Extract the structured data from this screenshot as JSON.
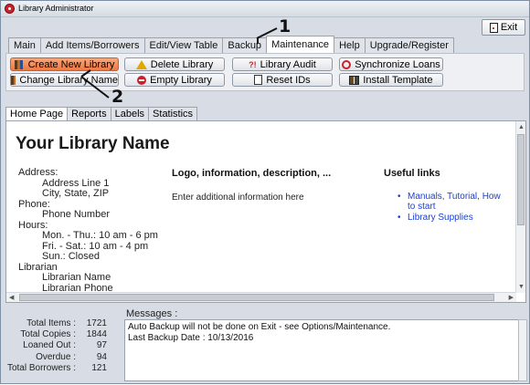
{
  "window": {
    "title": "Library Administrator"
  },
  "toolbar": {
    "exit_label": "Exit"
  },
  "main_tabs": [
    {
      "label": "Main"
    },
    {
      "label": "Add Items/Borrowers"
    },
    {
      "label": "Edit/View Table"
    },
    {
      "label": "Backup"
    },
    {
      "label": "Maintenance"
    },
    {
      "label": "Help"
    },
    {
      "label": "Upgrade/Register"
    }
  ],
  "ribbon": {
    "create_new_library": "Create New Library",
    "change_library_name": "Change Library Name",
    "delete_library": "Delete Library",
    "empty_library": "Empty Library",
    "library_audit": "Library Audit",
    "reset_ids": "Reset IDs",
    "synchronize_loans": "Synchronize Loans",
    "install_template": "Install Template",
    "audit_icon_text": "?!"
  },
  "sub_tabs": [
    {
      "label": "Home Page"
    },
    {
      "label": "Reports"
    },
    {
      "label": "Labels"
    },
    {
      "label": "Statistics"
    }
  ],
  "home": {
    "library_name": "Your Library Name",
    "address_lines": [
      {
        "text": "Address:",
        "indent": false
      },
      {
        "text": "Address Line 1",
        "indent": true
      },
      {
        "text": "City, State, ZIP",
        "indent": true
      },
      {
        "text": "Phone:",
        "indent": false
      },
      {
        "text": "Phone Number",
        "indent": true
      },
      {
        "text": "Hours:",
        "indent": false
      },
      {
        "text": "Mon. - Thu.: 10 am - 6 pm",
        "indent": true
      },
      {
        "text": "Fri. - Sat.: 10 am - 4 pm",
        "indent": true
      },
      {
        "text": "Sun.: Closed",
        "indent": true
      },
      {
        "text": "Librarian",
        "indent": false
      },
      {
        "text": "Librarian Name",
        "indent": true
      },
      {
        "text": "Librarian Phone",
        "indent": true
      }
    ],
    "middle_heading": "Logo, information, description, ...",
    "middle_text": "Enter additional information here",
    "links_heading": "Useful links",
    "links": [
      "Manuals, Tutorial, How to start",
      "Library Supplies"
    ]
  },
  "stats": [
    {
      "label": "Total Items :",
      "value": "1721"
    },
    {
      "label": "Total Copies :",
      "value": "1844"
    },
    {
      "label": "Loaned Out :",
      "value": "97"
    },
    {
      "label": "Overdue :",
      "value": "94"
    },
    {
      "label": "Total Borrowers :",
      "value": "121"
    }
  ],
  "messages": {
    "label": "Messages :",
    "lines": [
      "Auto Backup will not be done on Exit - see Options/Maintenance.",
      "Last Backup Date : 10/13/2016"
    ]
  },
  "annotations": {
    "callout_1": "1",
    "callout_2": "2"
  }
}
